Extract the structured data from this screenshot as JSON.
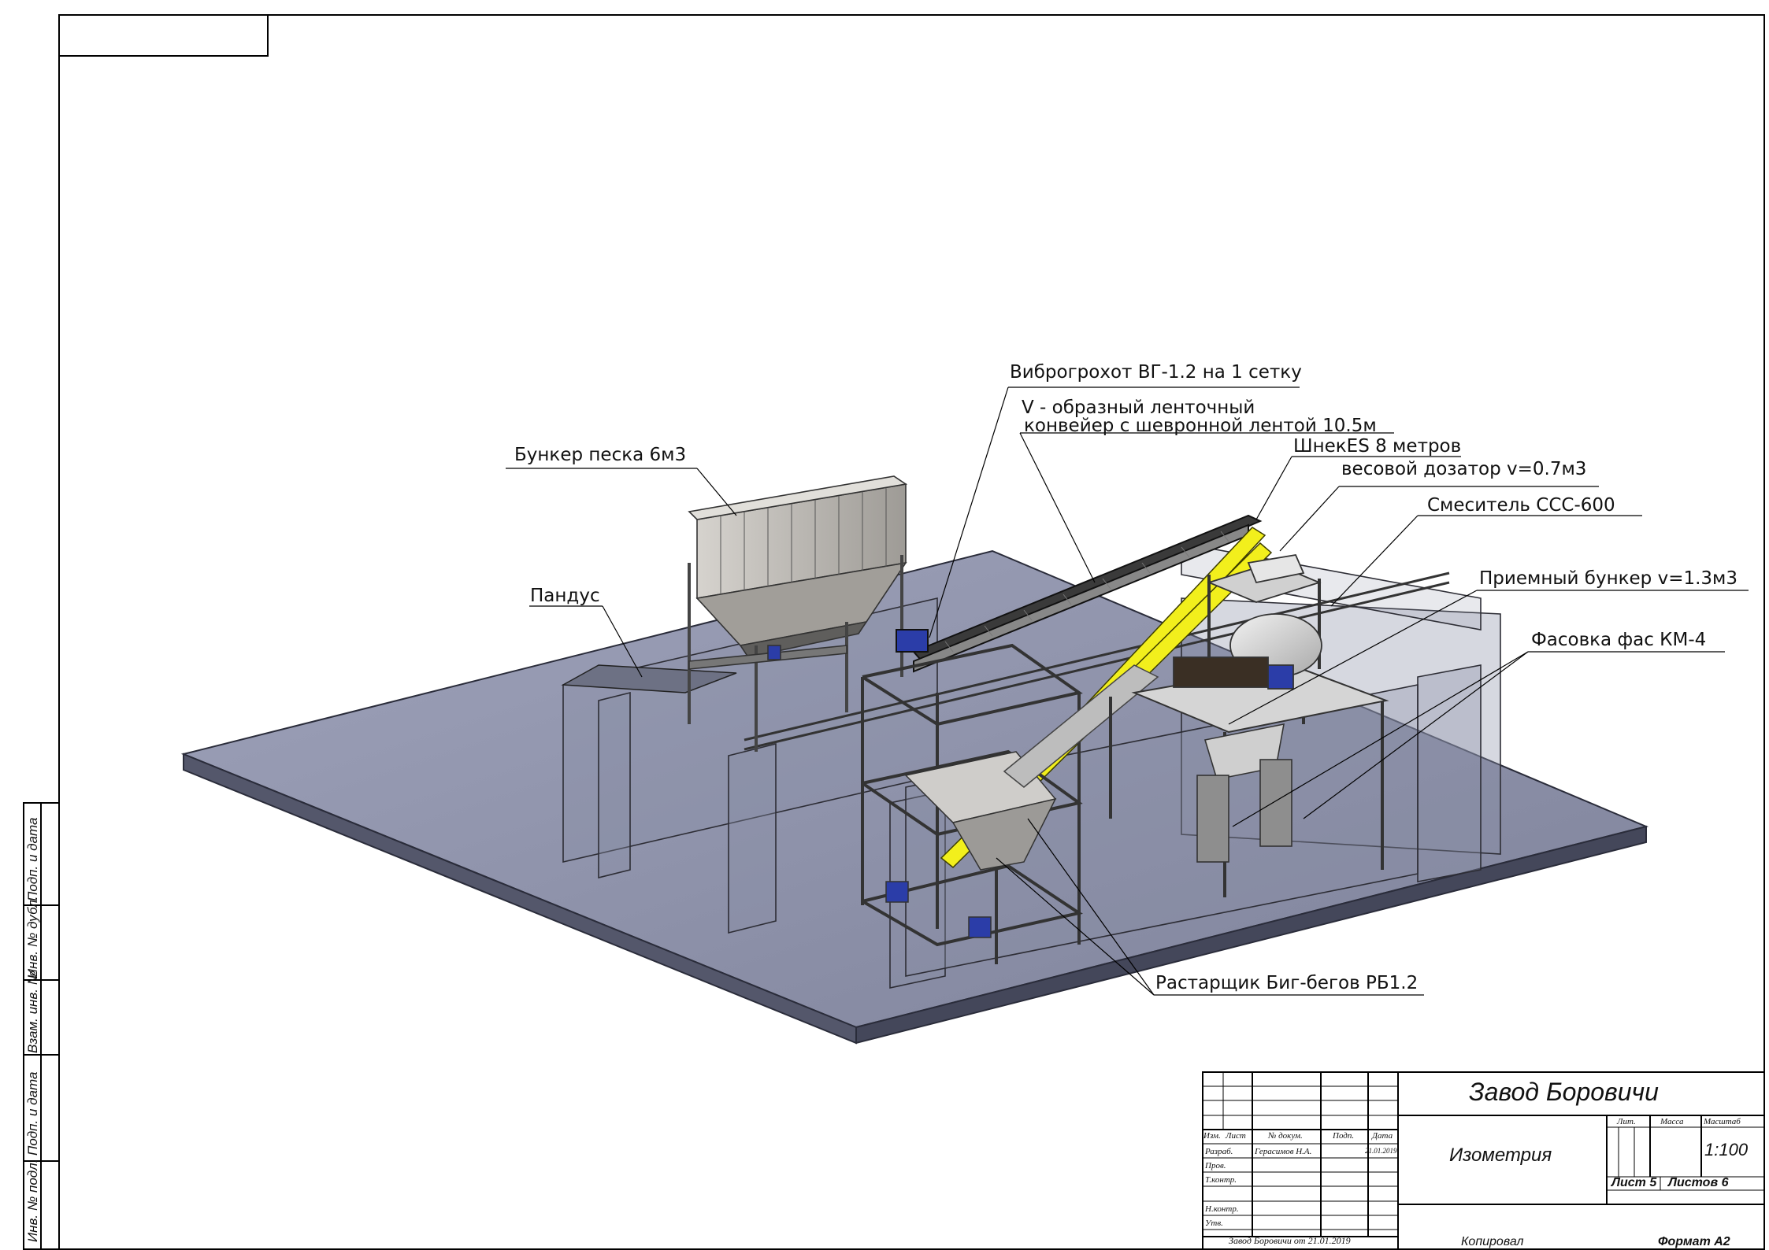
{
  "drawing": {
    "callouts": [
      "Виброгрохот ВГ-1.2 на 1 сетку",
      "V - образный ленточный",
      "конвейер с шевронной лентой 10.5м",
      "ШнекES 8 метров",
      "весовой дозатор v=0.7м3",
      "Бункер песка 6м3",
      "Смеситель ССС-600",
      "Пандус",
      "Приемный бункер v=1.3м3",
      "Фасовка фас КМ-4",
      "Растарщик Биг-бегов РБ1.2"
    ]
  },
  "title_block": {
    "company": "Завод Боровичи",
    "drawing_title": "Изометрия",
    "col_headers": [
      "Изм.",
      "Лист",
      "№ докум.",
      "Подп.",
      "Дата"
    ],
    "role_rows": [
      "Разраб.",
      "Пров.",
      "Т.контр.",
      "Н.контр.",
      "Утв."
    ],
    "developer": "Герасимов Н.А.",
    "date": "21.01.2019",
    "lit_label": "Лит.",
    "mass_label": "Масса",
    "scale_label": "Масштаб",
    "scale": "1:100",
    "sheet": "Лист 5",
    "sheets": "Листов 6",
    "file_name": "Завод Боровичи от 21.01.2019",
    "copied": "Копировал",
    "format": "Формат А2"
  },
  "side_stamp": [
    "Инв. № подл.",
    "Подп. и дата",
    "Взам. инв. №",
    "Инв. № дубл.",
    "Подп. и дата"
  ]
}
